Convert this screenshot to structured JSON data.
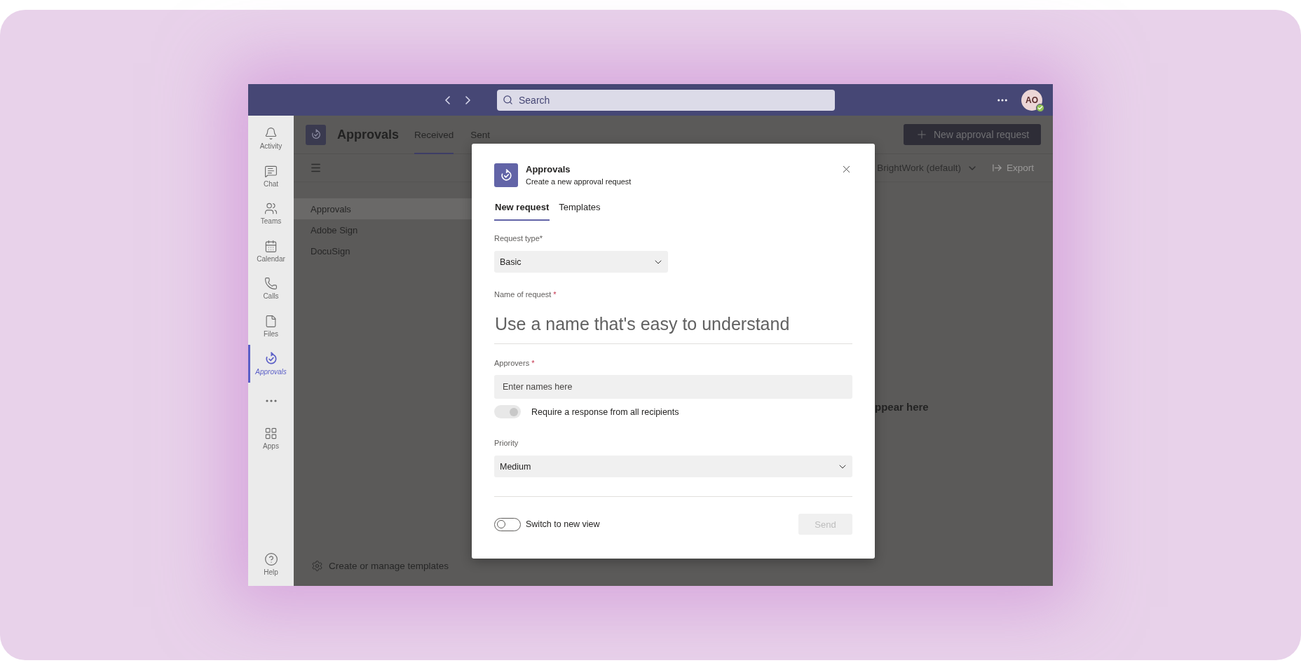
{
  "top_bar": {
    "search": {
      "placeholder": "Search"
    },
    "avatar": {
      "initials": "AO"
    }
  },
  "rail": {
    "items": [
      {
        "kind": "app",
        "label": "Activity",
        "selected": false
      },
      {
        "kind": "app",
        "label": "Chat",
        "selected": false
      },
      {
        "kind": "app",
        "label": "Teams",
        "selected": false
      },
      {
        "kind": "app",
        "label": "Calendar",
        "selected": false
      },
      {
        "kind": "app",
        "label": "Calls",
        "selected": false
      },
      {
        "kind": "app",
        "label": "Files",
        "selected": false
      },
      {
        "kind": "app",
        "label": "Approvals",
        "selected": true
      },
      {
        "kind": "more",
        "selected": false
      },
      {
        "kind": "app",
        "label": "Apps",
        "selected": false
      }
    ],
    "help": {
      "label": "Help"
    }
  },
  "app_header": {
    "title": "Approvals",
    "tabs": [
      {
        "label": "Received",
        "selected": true
      },
      {
        "label": "Sent",
        "selected": false
      }
    ],
    "new_button": "New approval request"
  },
  "toolbar": {
    "filter": "BrightWork (default)",
    "export": "Export"
  },
  "sidebar": {
    "items": [
      {
        "label": "Approvals",
        "selected": true
      },
      {
        "label": "Adobe Sign",
        "selected": false
      },
      {
        "label": "DocuSign",
        "selected": false
      }
    ],
    "footer_link": "Create or manage templates"
  },
  "empty_state": {
    "text": "ppear here"
  },
  "dialog": {
    "title": "Approvals",
    "subtitle": "Create a new approval request",
    "tabs": [
      {
        "label": "New request",
        "selected": true
      },
      {
        "label": "Templates",
        "selected": false
      }
    ],
    "request_type": {
      "label": "Request type*",
      "value": "Basic"
    },
    "name": {
      "label": "Name of request",
      "required_mark": "*",
      "placeholder": "Use a name that's easy to understand"
    },
    "approvers": {
      "label": "Approvers",
      "required_mark": "*",
      "placeholder": "Enter names here"
    },
    "require_all": {
      "label": "Require a response from all recipients",
      "on": true,
      "disabled": true
    },
    "priority": {
      "label": "Priority",
      "value": "Medium"
    },
    "switch_view": {
      "label": "Switch to new view",
      "on": false
    },
    "send_button": {
      "label": "Send",
      "disabled": true
    }
  }
}
